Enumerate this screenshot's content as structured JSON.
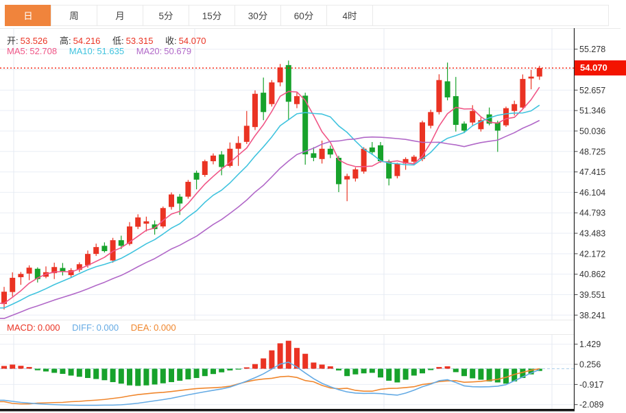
{
  "window_title": "K线图",
  "tabs": {
    "items": [
      {
        "label": "日",
        "active": true
      },
      {
        "label": "周",
        "active": false
      },
      {
        "label": "月",
        "active": false
      },
      {
        "label": "5分",
        "active": false
      },
      {
        "label": "15分",
        "active": false
      },
      {
        "label": "30分",
        "active": false
      },
      {
        "label": "60分",
        "active": false
      },
      {
        "label": "4时",
        "active": false
      }
    ]
  },
  "ohlc_header": {
    "open_label": "开:",
    "open": "53.526",
    "high_label": "高:",
    "high": "54.216",
    "low_label": "低:",
    "low": "53.315",
    "close_label": "收:",
    "close": "54.070"
  },
  "ma_header": {
    "ma5_label": "MA5:",
    "ma5": "52.708",
    "ma10_label": "MA10:",
    "ma10": "51.635",
    "ma20_label": "MA20:",
    "ma20": "50.679"
  },
  "macd_header": {
    "macd_label": "MACD:",
    "macd": "0.000",
    "diff_label": "DIFF:",
    "diff": "0.000",
    "dea_label": "DEA:",
    "dea": "0.000"
  },
  "price_axis": {
    "current_price_label": "54.070",
    "labels": [
      "55.278",
      "",
      "52.657",
      "51.346",
      "50.036",
      "48.725",
      "47.415",
      "46.104",
      "44.793",
      "43.483",
      "42.172",
      "40.862",
      "39.551",
      "38.241"
    ]
  },
  "macd_axis": {
    "labels": [
      "1.429",
      "0.256",
      "-0.917",
      "-2.089"
    ],
    "values": [
      1.429,
      0.256,
      -0.917,
      -2.089
    ]
  },
  "colors": {
    "accent": "#f0843c",
    "up": "#ea3323",
    "down": "#17a22b",
    "ma5": "#f05586",
    "ma10": "#3fc3de",
    "ma20": "#b168c8",
    "diff": "#64aae4",
    "dea": "#f0862c",
    "price_tag": "#f31400",
    "grid": "#e9eef6",
    "grid_vertical": "#e4eaf2",
    "axis_line": "#222222",
    "text": "#333333",
    "label_dark": "#333333",
    "border": "#e9e9e9",
    "zero_dash": "#a9cdea",
    "bottom_bar": "#151515"
  },
  "chart_data": [
    {
      "type": "candlestick",
      "title": "",
      "period_selected": "日",
      "current_price": 54.07,
      "y_axis": {
        "max": 55.278,
        "min": 38.241,
        "divisions": 13
      },
      "ohlc_series": [
        [
          38.95,
          40.05,
          38.6,
          39.74
        ],
        [
          39.72,
          40.98,
          39.43,
          40.63
        ],
        [
          40.67,
          41.0,
          40.18,
          40.88
        ],
        [
          40.9,
          41.43,
          40.48,
          41.28
        ],
        [
          41.21,
          41.3,
          40.33,
          40.55
        ],
        [
          40.7,
          41.36,
          40.6,
          40.99
        ],
        [
          40.93,
          41.6,
          40.55,
          41.32
        ],
        [
          41.26,
          41.58,
          40.78,
          41.03
        ],
        [
          40.8,
          41.25,
          40.65,
          41.12
        ],
        [
          41.14,
          41.62,
          41.0,
          41.5
        ],
        [
          41.43,
          42.38,
          41.28,
          42.16
        ],
        [
          42.16,
          42.82,
          42.03,
          42.6
        ],
        [
          42.68,
          42.9,
          42.25,
          42.34
        ],
        [
          41.74,
          43.19,
          41.6,
          43.04
        ],
        [
          43.04,
          43.33,
          42.47,
          42.68
        ],
        [
          42.8,
          44.2,
          42.7,
          43.92
        ],
        [
          43.9,
          44.7,
          43.75,
          44.5
        ],
        [
          44.1,
          44.55,
          43.6,
          44.25
        ],
        [
          44.05,
          44.3,
          43.4,
          43.75
        ],
        [
          43.92,
          45.2,
          43.8,
          45.1
        ],
        [
          45.17,
          46.1,
          45.0,
          45.97
        ],
        [
          45.83,
          46.0,
          44.66,
          45.39
        ],
        [
          45.83,
          46.9,
          45.7,
          46.78
        ],
        [
          47.36,
          47.5,
          46.3,
          46.92
        ],
        [
          47.22,
          48.2,
          47.1,
          48.1
        ],
        [
          48.1,
          48.6,
          47.9,
          48.46
        ],
        [
          48.53,
          48.75,
          47.2,
          47.73
        ],
        [
          47.8,
          49.3,
          47.7,
          48.9
        ],
        [
          48.9,
          49.7,
          47.8,
          49.27
        ],
        [
          49.34,
          51.32,
          49.2,
          50.37
        ],
        [
          50.29,
          52.64,
          50.1,
          52.42
        ],
        [
          52.49,
          53.46,
          50.73,
          51.25
        ],
        [
          51.76,
          53.3,
          51.6,
          53.15
        ],
        [
          53.15,
          54.33,
          52.9,
          54.11
        ],
        [
          54.26,
          54.55,
          50.73,
          51.91
        ],
        [
          51.76,
          52.5,
          51.5,
          52.27
        ],
        [
          52.3,
          52.49,
          47.88,
          48.54
        ],
        [
          48.61,
          49.0,
          48.1,
          48.32
        ],
        [
          48.24,
          49.42,
          47.95,
          48.9
        ],
        [
          48.9,
          49.1,
          48.3,
          48.53
        ],
        [
          48.32,
          48.45,
          46.12,
          46.63
        ],
        [
          46.93,
          47.3,
          45.54,
          47.15
        ],
        [
          46.99,
          47.7,
          46.8,
          47.58
        ],
        [
          47.44,
          49.0,
          47.3,
          48.9
        ],
        [
          48.98,
          49.33,
          48.5,
          48.68
        ],
        [
          49.12,
          49.33,
          48.0,
          48.1
        ],
        [
          48.1,
          48.2,
          46.55,
          46.99
        ],
        [
          47.15,
          48.0,
          47.0,
          47.95
        ],
        [
          47.95,
          48.35,
          47.55,
          48.24
        ],
        [
          48.07,
          48.5,
          47.9,
          48.39
        ],
        [
          48.24,
          50.7,
          48.1,
          50.59
        ],
        [
          50.37,
          51.4,
          50.2,
          51.25
        ],
        [
          51.25,
          53.67,
          51.1,
          53.3
        ],
        [
          53.22,
          54.42,
          52.0,
          52.19
        ],
        [
          52.27,
          53.5,
          50.0,
          50.43
        ],
        [
          50.51,
          50.65,
          49.9,
          50.06
        ],
        [
          50.58,
          51.69,
          50.37,
          51.32
        ],
        [
          50.15,
          50.9,
          50.0,
          50.73
        ],
        [
          51.1,
          51.54,
          50.4,
          50.51
        ],
        [
          50.59,
          50.7,
          48.7,
          50.06
        ],
        [
          50.4,
          51.6,
          50.3,
          51.5
        ],
        [
          51.32,
          51.98,
          51.03,
          51.76
        ],
        [
          51.54,
          53.66,
          51.45,
          53.37
        ],
        [
          53.4,
          53.95,
          52.71,
          53.52
        ],
        [
          53.526,
          54.216,
          53.315,
          54.07
        ]
      ],
      "moving_averages": {
        "periods": [
          5,
          10,
          20
        ],
        "current": {
          "ma5": "52.708",
          "ma10": "51.635",
          "ma20": "50.679"
        },
        "seed_prior_closes": [
          36.5,
          36.7,
          36.9,
          37.1,
          37.3,
          37.5,
          37.65,
          37.8,
          37.95,
          38.1,
          38.2,
          38.3,
          38.4,
          38.5,
          38.6,
          38.7,
          38.8,
          38.85,
          38.9
        ]
      }
    },
    {
      "type": "macd",
      "current": {
        "macd": "0.000",
        "diff": "0.000",
        "dea": "0.000"
      },
      "y_axis": {
        "ticks": [
          1.429,
          0.256,
          -0.917,
          -2.089
        ]
      },
      "diff": [
        -1.84,
        -1.9,
        -1.96,
        -2.0,
        -2.04,
        -2.07,
        -2.09,
        -2.11,
        -2.12,
        -2.13,
        -2.13,
        -2.13,
        -2.12,
        -2.12,
        -2.1,
        -2.06,
        -2.01,
        -1.94,
        -1.87,
        -1.8,
        -1.72,
        -1.62,
        -1.52,
        -1.43,
        -1.34,
        -1.26,
        -1.18,
        -1.07,
        -0.9,
        -0.72,
        -0.52,
        -0.3,
        -0.02,
        0.27,
        0.38,
        0.1,
        -0.25,
        -0.58,
        -0.85,
        -1.05,
        -1.22,
        -1.35,
        -1.42,
        -1.44,
        -1.43,
        -1.45,
        -1.5,
        -1.54,
        -1.42,
        -1.25,
        -1.05,
        -0.9,
        -0.7,
        -0.64,
        -0.8,
        -1.0,
        -1.05,
        -1.06,
        -1.05,
        -1.02,
        -0.93,
        -0.7,
        -0.48,
        -0.25,
        -0.05
      ],
      "dea": [
        -1.92,
        -2.02,
        -2.05,
        -2.05,
        -2.0,
        -1.99,
        -1.97,
        -1.96,
        -1.92,
        -1.9,
        -1.86,
        -1.83,
        -1.79,
        -1.73,
        -1.67,
        -1.58,
        -1.51,
        -1.46,
        -1.41,
        -1.38,
        -1.33,
        -1.27,
        -1.21,
        -1.16,
        -1.13,
        -1.11,
        -1.08,
        -1.02,
        -0.88,
        -0.76,
        -0.66,
        -0.6,
        -0.56,
        -0.47,
        -0.44,
        -0.51,
        -0.69,
        -0.76,
        -0.97,
        -1.12,
        -1.17,
        -1.14,
        -1.26,
        -1.31,
        -1.31,
        -1.2,
        -1.15,
        -1.14,
        -1.1,
        -1.05,
        -0.92,
        -0.86,
        -0.75,
        -0.71,
        -0.7,
        -0.79,
        -0.77,
        -0.74,
        -0.68,
        -0.62,
        -0.5,
        -0.33,
        -0.21,
        -0.09,
        0.0
      ],
      "histogram": [
        0.16,
        0.24,
        0.17,
        0.1,
        -0.09,
        -0.16,
        -0.24,
        -0.3,
        -0.4,
        -0.47,
        -0.54,
        -0.6,
        -0.67,
        -0.78,
        -0.87,
        -0.97,
        -1.0,
        -0.97,
        -0.92,
        -0.85,
        -0.78,
        -0.7,
        -0.62,
        -0.54,
        -0.43,
        -0.31,
        -0.21,
        -0.1,
        -0.05,
        0.08,
        0.27,
        0.6,
        1.07,
        1.48,
        1.63,
        1.21,
        0.87,
        0.36,
        0.24,
        0.14,
        -0.1,
        -0.43,
        -0.33,
        -0.27,
        -0.24,
        -0.51,
        -0.7,
        -0.8,
        -0.64,
        -0.4,
        -0.27,
        -0.08,
        0.1,
        0.14,
        -0.2,
        -0.43,
        -0.56,
        -0.64,
        -0.74,
        -0.8,
        -0.87,
        -0.74,
        -0.54,
        -0.33,
        -0.13
      ]
    }
  ]
}
